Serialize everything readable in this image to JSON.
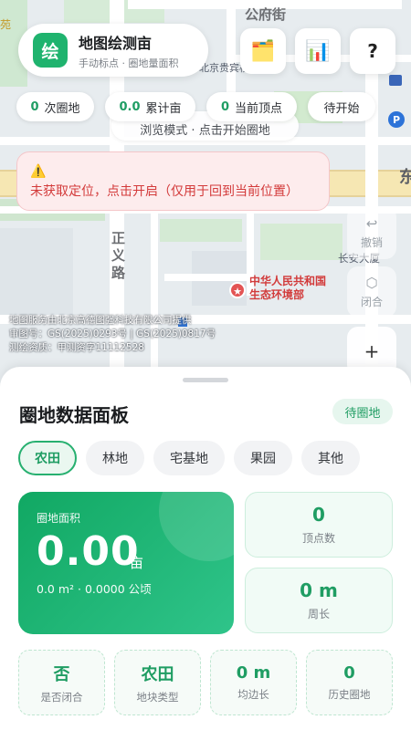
{
  "map": {
    "street_top": "公府街",
    "street_side": "正义路",
    "poi_name_line1": "中华人民共和国",
    "poi_name_line2": "生态环境部",
    "hotel_label": "北京贵宾楼",
    "building_label": "长安大厦",
    "edge_char_left": "苑",
    "edge_char_right": "东",
    "behind_pill_text": "浏览模式 · 点击开始圈地",
    "attribution": [
      "地图服务由北京高德图强科技有限公司提供",
      "审图号：GS(2025)0293号 | GS(2025)0817号",
      "测绘资质：甲测资字11112528"
    ]
  },
  "header": {
    "logo_char": "绘",
    "title": "地图绘测亩",
    "subtitle": "手动标点 · 圈地量面积",
    "buttons": [
      {
        "icon": "folder-icon",
        "glyph": "🗂️"
      },
      {
        "icon": "chart-icon",
        "glyph": "📊"
      },
      {
        "icon": "help-icon",
        "glyph": "?"
      }
    ]
  },
  "stats": {
    "plots_value": "0",
    "plots_label": "次圈地",
    "mu_value": "0.0",
    "mu_label": "累计亩",
    "vertex_value": "0",
    "vertex_label": "当前顶点",
    "state_label": "待开始"
  },
  "alert": {
    "icon": "warning-icon",
    "glyph": "⚠️",
    "text": "未获取定位，点击开启（仅用于回到当前位置）"
  },
  "side_controls": {
    "undo_glyph": "↩",
    "undo_label": "撤销",
    "close_glyph": "⬡",
    "close_label": "闭合",
    "zoom_in_glyph": "+"
  },
  "panel": {
    "title": "圈地数据面板",
    "status": "待圈地",
    "land_types": [
      "农田",
      "林地",
      "宅基地",
      "果园",
      "其他"
    ],
    "active_type_index": 0,
    "area_label": "圈地面积",
    "area_value": "0.00",
    "area_unit": "亩",
    "area_sub": "0.0 m² · 0.0000 公顷",
    "vertices_value": "0",
    "vertices_label": "顶点数",
    "perimeter_value": "0 m",
    "perimeter_label": "周长",
    "closed_value": "否",
    "closed_label": "是否闭合",
    "type_value": "农田",
    "type_label": "地块类型",
    "avg_edge_value": "0 m",
    "avg_edge_label": "均边长",
    "history_value": "0",
    "history_label": "历史圈地"
  },
  "colors": {
    "accent": "#1f9d63",
    "alert_text": "#d33a3a",
    "alert_bg": "#fdeced"
  }
}
